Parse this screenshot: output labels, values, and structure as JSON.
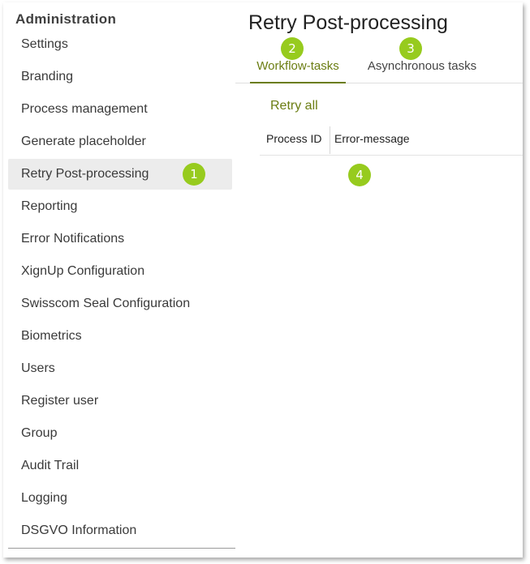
{
  "sidebar": {
    "heading": "Administration",
    "items": [
      {
        "label": "Settings"
      },
      {
        "label": "Branding"
      },
      {
        "label": "Process management"
      },
      {
        "label": "Generate placeholder"
      },
      {
        "label": "Retry Post-processing",
        "active": true
      },
      {
        "label": "Reporting"
      },
      {
        "label": "Error Notifications"
      },
      {
        "label": "XignUp Configuration"
      },
      {
        "label": "Swisscom Seal Configuration"
      },
      {
        "label": "Biometrics"
      },
      {
        "label": "Users"
      },
      {
        "label": "Register user"
      },
      {
        "label": "Group"
      },
      {
        "label": "Audit Trail"
      },
      {
        "label": "Logging"
      },
      {
        "label": "DSGVO Information"
      }
    ]
  },
  "main": {
    "title": "Retry Post-processing",
    "tabs": [
      {
        "label": "Workflow-tasks",
        "active": true
      },
      {
        "label": "Asynchronous tasks",
        "active": false
      }
    ],
    "retry_all_label": "Retry all",
    "table": {
      "columns": [
        "Process ID",
        "Error-message"
      ],
      "rows": []
    }
  },
  "callouts": [
    "1",
    "2",
    "3",
    "4"
  ],
  "colors": {
    "accent": "#6b7d12",
    "callout": "#97cb1e",
    "active_item_bg": "#ececec"
  }
}
